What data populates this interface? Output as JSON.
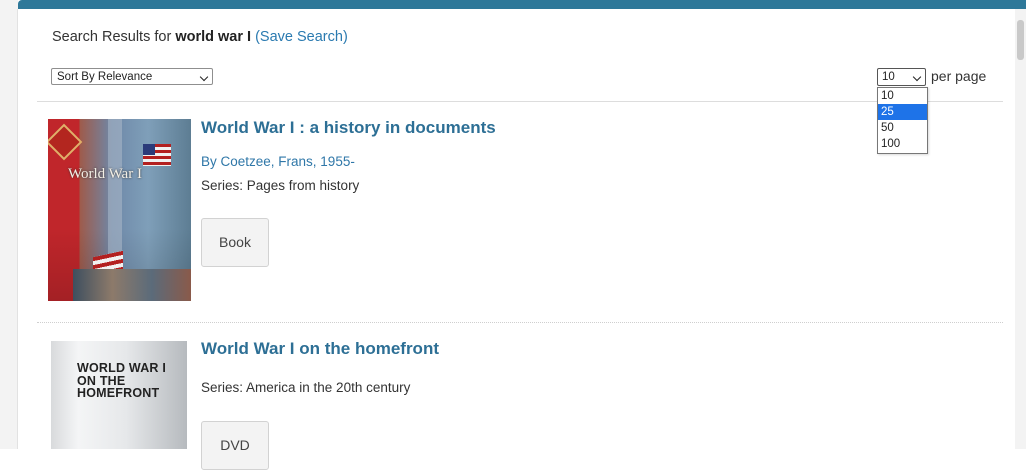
{
  "header": {
    "prefix": "Search Results for ",
    "query": "world war I",
    "save_search": "(Save Search)"
  },
  "sort": {
    "selected": "Sort By Relevance"
  },
  "per_page": {
    "selected": "10",
    "label": "per page",
    "options": [
      "10",
      "25",
      "50",
      "100"
    ],
    "highlighted_option": "25"
  },
  "results": [
    {
      "title": "World War I : a history in documents",
      "author": "By Coetzee, Frans, 1955-",
      "series": "Series: Pages from history",
      "format": "Book",
      "cover_text": "World War I"
    },
    {
      "title": "World War I on the homefront",
      "series": "Series: America in the 20th century",
      "format": "DVD",
      "cover_text": "WORLD WAR I ON THE HOMEFRONT"
    }
  ],
  "colors": {
    "accent_bar": "#2e7899",
    "title_link": "#2d6f95",
    "link": "#2a7ab0",
    "option_highlight": "#1e73e8"
  }
}
